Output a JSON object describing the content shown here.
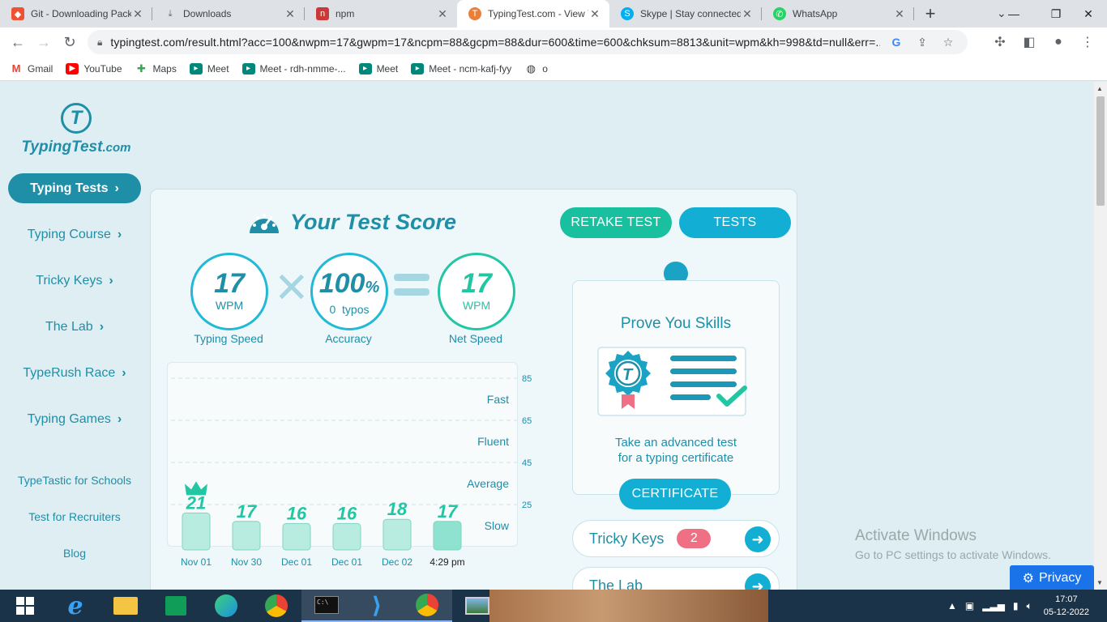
{
  "browser": {
    "tabs": [
      {
        "title": "Git - Downloading Pack",
        "icon": "git-icon",
        "color": "#f05133"
      },
      {
        "title": "Downloads",
        "icon": "download-icon",
        "color": "#5f6368"
      },
      {
        "title": "npm",
        "icon": "npm-icon",
        "color": "#cb3837"
      },
      {
        "title": "TypingTest.com - View Y",
        "icon": "typingtest-icon",
        "color": "#e8803a",
        "active": true
      },
      {
        "title": "Skype | Stay connected",
        "icon": "skype-icon",
        "color": "#00aff0"
      },
      {
        "title": "WhatsApp",
        "icon": "whatsapp-icon",
        "color": "#25d366"
      }
    ],
    "url": "typingtest.com/result.html?acc=100&nwpm=17&gwpm=17&ncpm=88&gcpm=88&dur=600&time=600&chksum=8813&unit=wpm&kh=998&td=null&err=...",
    "bookmarks": [
      {
        "label": "Gmail",
        "icon": "gmail-icon",
        "color": "#ea4335"
      },
      {
        "label": "YouTube",
        "icon": "youtube-icon",
        "color": "#ff0000"
      },
      {
        "label": "Maps",
        "icon": "maps-icon",
        "color": "#34a853"
      },
      {
        "label": "Meet",
        "icon": "meet-icon",
        "color": "#00897b"
      },
      {
        "label": "Meet - rdh-nmme-...",
        "icon": "meet-icon",
        "color": "#00897b"
      },
      {
        "label": "Meet",
        "icon": "meet-icon",
        "color": "#00897b"
      },
      {
        "label": "Meet - ncm-kafj-fyy",
        "icon": "meet-icon",
        "color": "#00897b"
      },
      {
        "label": "o",
        "icon": "globe-icon",
        "color": "#5f6368"
      }
    ]
  },
  "site": {
    "logo_text": "TypingTest",
    "logo_suffix": ".com",
    "nav": [
      {
        "label": "Typing Tests",
        "active": true
      },
      {
        "label": "Typing Course"
      },
      {
        "label": "Tricky Keys"
      },
      {
        "label": "The Lab"
      },
      {
        "label": "TypeRush Race"
      },
      {
        "label": "Typing Games"
      }
    ],
    "links": [
      "TypeTastic for Schools",
      "Test for Recruiters",
      "Blog"
    ]
  },
  "score": {
    "title": "Your Test Score",
    "retake_label": "RETAKE TEST",
    "tests_label": "TESTS",
    "typing_speed": {
      "value": "17",
      "unit": "WPM",
      "label": "Typing Speed"
    },
    "accuracy": {
      "value": "100",
      "unit": "%",
      "sub_count": "0",
      "sub_label": "typos",
      "label": "Accuracy"
    },
    "net_speed": {
      "value": "17",
      "unit": "WPM",
      "label": "Net Speed"
    }
  },
  "chart_data": {
    "type": "bar",
    "categories": [
      "Nov 01",
      "Nov 30",
      "Dec 01",
      "Dec 01",
      "Dec 02",
      "4:29 pm"
    ],
    "values": [
      21,
      17,
      16,
      16,
      18,
      17
    ],
    "ylim": [
      5,
      85
    ],
    "yticks": [
      85,
      65,
      45,
      25
    ],
    "bands": [
      "Fast",
      "Fluent",
      "Average",
      "Slow"
    ],
    "best_index": 0,
    "current_index": 5,
    "colors": {
      "bar": "#b8ece0",
      "bar_current": "#8fe2cf",
      "bar_stroke": "#7fd5c0",
      "value": "#23c6a3"
    }
  },
  "certificate": {
    "heading": "Prove You Skills",
    "text_line1": "Take an advanced test",
    "text_line2": "for a typing certificate",
    "button_label": "CERTIFICATE"
  },
  "extras": [
    {
      "label": "Tricky Keys",
      "badge": "2"
    },
    {
      "label": "The Lab"
    }
  ],
  "windows": {
    "watermark_title": "Activate Windows",
    "watermark_sub": "Go to PC settings to activate Windows.",
    "privacy_label": "Privacy",
    "time": "17:07",
    "date": "05-12-2022"
  },
  "colors": {
    "accent": "#1f8ea7",
    "teal_button": "#19c0a0",
    "blue_button": "#13aed4",
    "badge": "#ef6f85"
  }
}
